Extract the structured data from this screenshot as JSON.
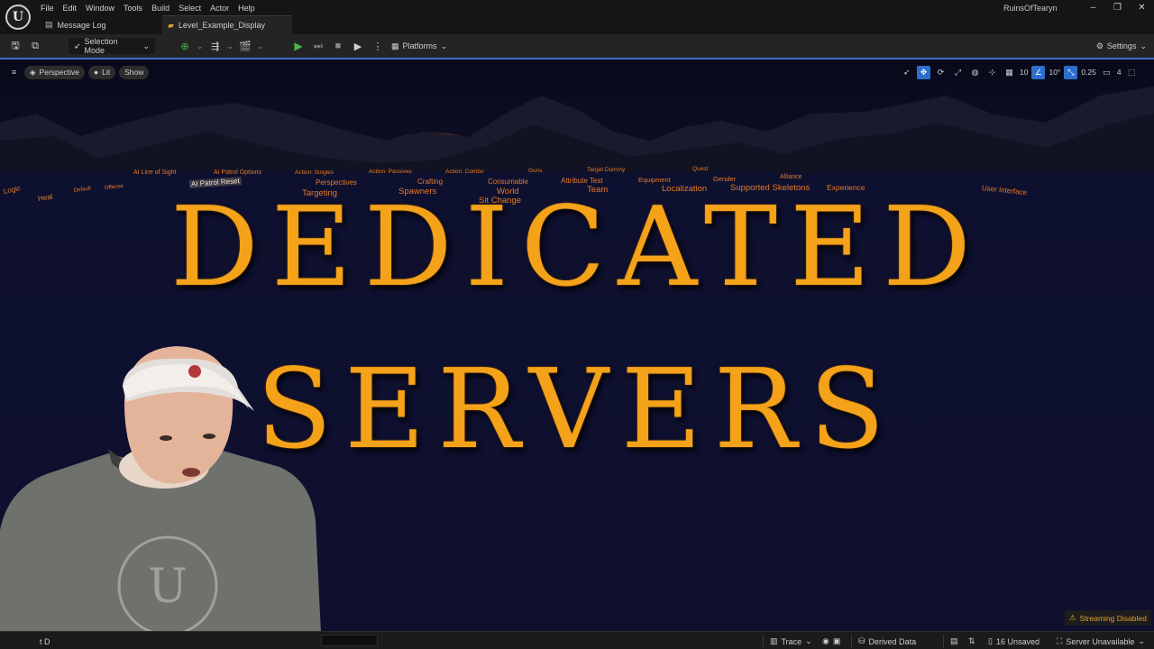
{
  "menu": {
    "items": [
      "File",
      "Edit",
      "Window",
      "Tools",
      "Build",
      "Select",
      "Actor",
      "Help"
    ]
  },
  "tabs": [
    {
      "label": "Message Log",
      "icon": "log-icon"
    },
    {
      "label": "Level_Example_Display",
      "icon": "level-icon"
    }
  ],
  "project_name": "RuinsOfTearyn",
  "toolbar": {
    "selection_mode": "Selection Mode",
    "platforms": "Platforms",
    "settings": "Settings"
  },
  "viewport_bar": {
    "perspective": "Perspective",
    "lit": "Lit",
    "show": "Show",
    "grid_snap": "10",
    "rotation_snap": "10°",
    "scale_snap": "0.25",
    "camera_speed": "4"
  },
  "level_labels": [
    "Logic",
    "Heal",
    "Default",
    "Offense",
    "AI Line of Sight",
    "AI Patrol Reset",
    "AI Patrol Options",
    "Action: Singles",
    "Targeting",
    "Perspectives",
    "Action: Passives",
    "Crafting",
    "Spawners",
    "Action: Combo",
    "Consumable",
    "World",
    "Sit Change",
    "Guns",
    "Attribute Test",
    "Team",
    "Target Dummy",
    "Equipment",
    "Localization",
    "Quest",
    "Gender",
    "Supported Skeletons",
    "Alliance",
    "Experience",
    "User Interface"
  ],
  "headline": {
    "line1": "DEDICATED",
    "line2": "SERVERS"
  },
  "statusbar": {
    "trace": "Trace",
    "derived_data": "Derived Data",
    "unsaved": "16 Unsaved",
    "server": "Server Unavailable",
    "streaming": "Streaming Disabled",
    "left_fragment": "t D"
  },
  "colors": {
    "accent_blue": "#2d6ecc",
    "label_orange": "#e87a26",
    "headline_gold": "#f3a21a",
    "play_green": "#47b447"
  }
}
